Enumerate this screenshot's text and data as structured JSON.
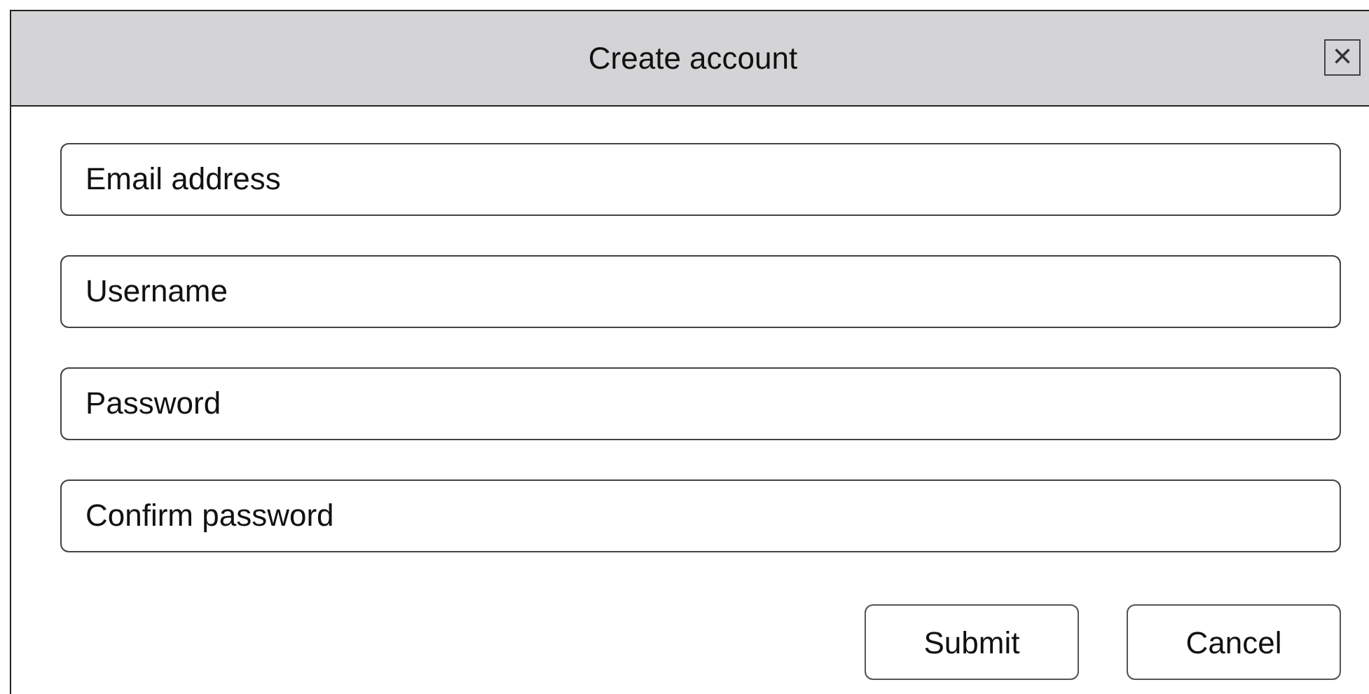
{
  "window": {
    "title": "Create account",
    "close": "×"
  },
  "fields": [
    {
      "placeholder": "Email address"
    },
    {
      "placeholder": "Username"
    },
    {
      "placeholder": "Password"
    },
    {
      "placeholder": "Confirm password"
    }
  ],
  "buttons": [
    "Submit",
    "Cancel"
  ]
}
